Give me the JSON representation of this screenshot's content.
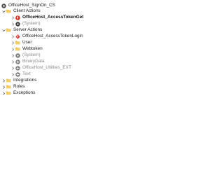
{
  "tree": {
    "root": {
      "label": "OfficeHost_SignOn_CS",
      "icon": "module-icon"
    },
    "client_actions": {
      "label": "Client Actions",
      "items": [
        {
          "label": "OfficeHost_AccessTokenGet",
          "icon": "client-action-icon",
          "selected": true
        },
        {
          "label": "(System)",
          "icon": "system-module-icon",
          "muted": true
        }
      ]
    },
    "server_actions": {
      "label": "Server Actions",
      "items": [
        {
          "label": "OfficeHost_AccessTokenLogin",
          "icon": "server-action-icon"
        },
        {
          "label": "User",
          "icon": "folder-icon"
        },
        {
          "label": "Webtoken",
          "icon": "folder-icon"
        },
        {
          "label": "(System)",
          "icon": "system-module-icon",
          "muted": true
        },
        {
          "label": "BinaryData",
          "icon": "extension-icon",
          "muted": true
        },
        {
          "label": "OfficeHost_Utilities_EXT",
          "icon": "extension-icon",
          "muted": true
        },
        {
          "label": "Text",
          "icon": "extension-icon",
          "muted": true
        }
      ]
    },
    "integrations": {
      "label": "Integrations"
    },
    "roles": {
      "label": "Roles"
    },
    "exceptions": {
      "label": "Exceptions"
    }
  },
  "colors": {
    "folder": "#e8b84a",
    "client_action": "#d9352b",
    "server_action": "#d9352b",
    "module": "#3a3a3a",
    "muted_text": "#8a8a8a"
  }
}
